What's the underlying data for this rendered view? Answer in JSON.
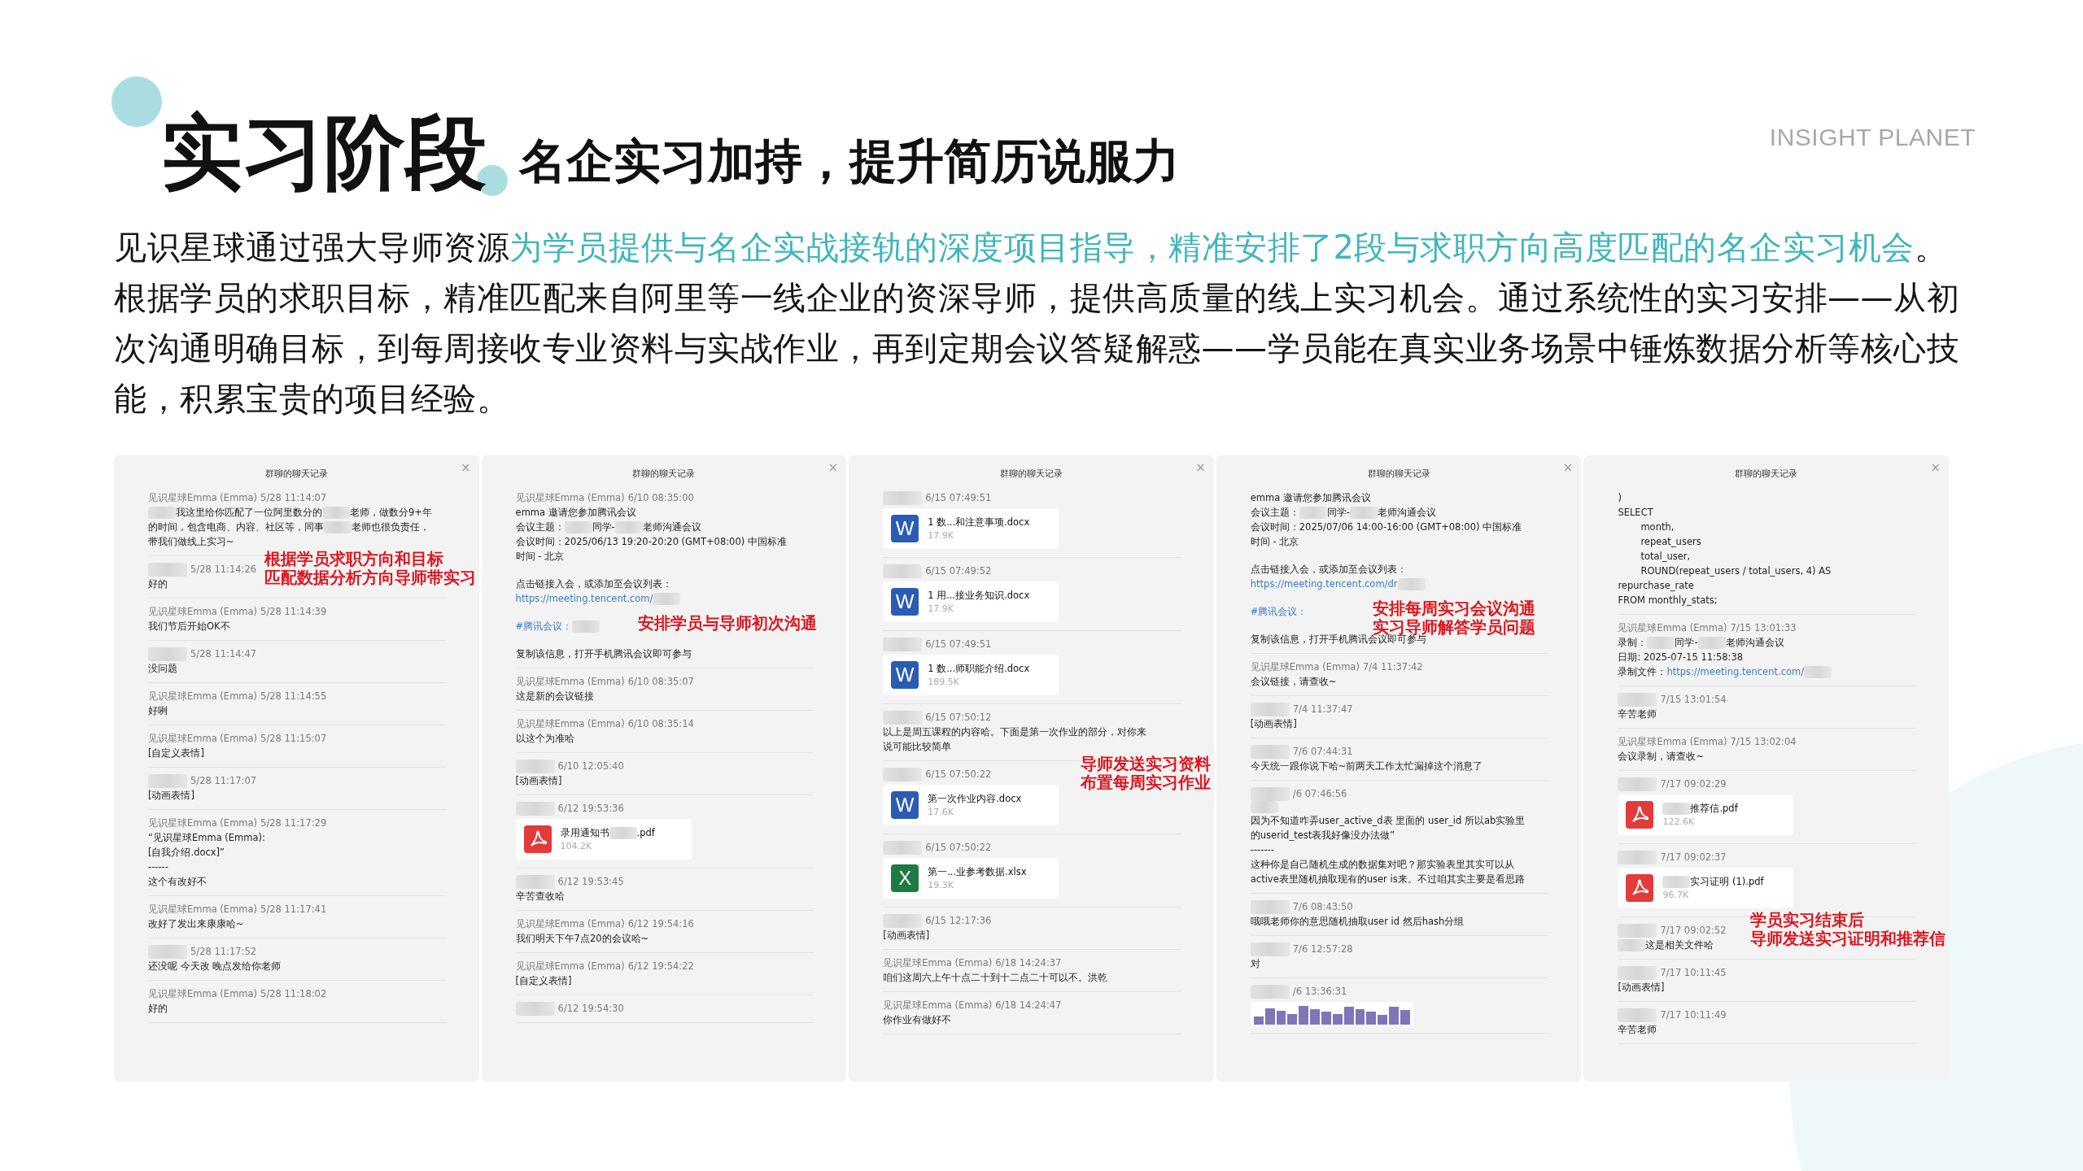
{
  "title": "实习阶段",
  "subtitle": "名企实习加持，提升简历说服力",
  "brand": "INSIGHT PLANET",
  "intro": [
    {
      "segments": [
        {
          "text": "见识星球通过强大导师资源",
          "highlight": false
        },
        {
          "text": "为学员提供与名企实战接轨的深度项目指导，精准安排了2段与求职方向高度匹配的名企实习机会",
          "highlight": true
        },
        {
          "text": "。",
          "highlight": false
        }
      ]
    },
    {
      "segments": [
        {
          "text": "根据学员的求职目标，精准匹配来自阿里等一线企业的资深导师，提供高质量的线上实习机会。通过系统性的实习安排——从初次沟通明确目标，到每周接收专业资料与实战作业，再到定期会议答疑解惑——学员能在真实业务场景中锤炼数据分析等核心技能，积累宝贵的项目经验。",
          "highlight": false
        }
      ]
    }
  ],
  "panels": [
    {
      "title": "群聊的聊天记录",
      "close": "×",
      "messages": [
        {
          "sender": "见识星球Emma (Emma)",
          "time": "5/28 11:14:07",
          "lines": [
            [
              {
                "kind": "blur"
              },
              "我这里给你匹配了一位阿里数分的",
              {
                "kind": "blur"
              },
              "老师，做数分9+年"
            ],
            [
              "的时间，包含电商、内容、社区等，同事",
              {
                "kind": "blur"
              },
              "老师也很负责任，"
            ],
            [
              "带我们做线上实习~"
            ]
          ]
        },
        {
          "time": "5/28 11:14:26",
          "lines": [
            [
              "好的"
            ]
          ],
          "note": [
            "根据学员求职方向和目标",
            "匹配数据分析方向导师带实习"
          ]
        },
        {
          "sender": "见识星球Emma (Emma)",
          "time": "5/28 11:14:39",
          "lines": [
            [
              "我们节后开始OK不"
            ]
          ]
        },
        {
          "time": "5/28 11:14:47",
          "lines": [
            [
              "没问题"
            ]
          ]
        },
        {
          "sender": "见识星球Emma (Emma)",
          "time": "5/28 11:14:55",
          "lines": [
            [
              "好咧"
            ]
          ]
        },
        {
          "sender": "见识星球Emma (Emma)",
          "time": "5/28 11:15:07",
          "lines": [
            [
              "[自定义表情]"
            ]
          ]
        },
        {
          "time": "5/28 11:17:07",
          "lines": [
            [
              "[动画表情]"
            ]
          ]
        },
        {
          "sender": "见识星球Emma (Emma)",
          "time": "5/28 11:17:29",
          "lines": [
            [
              "“见识星球Emma (Emma):"
            ],
            [
              "[自我介绍.docx]”"
            ],
            [
              "------"
            ],
            [
              "这个有改好不"
            ]
          ]
        },
        {
          "sender": "见识星球Emma (Emma)",
          "time": "5/28 11:17:41",
          "lines": [
            [
              "改好了发出来康康哈~"
            ]
          ]
        },
        {
          "time": "5/28 11:17:52",
          "lines": [
            [
              "还没呢 今天改 晚点发给你老师"
            ]
          ]
        },
        {
          "sender": "见识星球Emma (Emma)",
          "time": "5/28 11:18:02",
          "lines": [
            [
              "好的"
            ]
          ]
        }
      ]
    },
    {
      "title": "群聊的聊天记录",
      "close": "×",
      "messages": [
        {
          "sender": "见识星球Emma (Emma)",
          "time": "6/10 08:35:00",
          "lines": [
            [
              "emma 邀请您参加腾讯会议"
            ],
            [
              "会议主题：",
              {
                "kind": "blur"
              },
              "同学-",
              {
                "kind": "blur"
              },
              "老师沟通会议"
            ],
            [
              "会议时间：2025/06/13 19:20-20:20 (GMT+08:00) 中国标准"
            ],
            [
              "时间 - 北京"
            ],
            [
              {
                "kind": "gap"
              },
              "点击链接入会，或添加至会议列表："
            ],
            [
              {
                "kind": "link",
                "text": "https://meeting.tencent.com/"
              },
              {
                "kind": "blur"
              }
            ],
            [
              {
                "kind": "gap"
              },
              {
                "kind": "link",
                "text": "#腾讯会议："
              },
              {
                "kind": "blur"
              },
              {
                "kind": "note",
                "lines": [
                  "安排学员与导师初次沟通"
                ]
              }
            ],
            [
              {
                "kind": "gap"
              },
              "复制该信息，打开手机腾讯会议即可参与"
            ]
          ]
        },
        {
          "sender": "见识星球Emma (Emma)",
          "time": "6/10 08:35:07",
          "lines": [
            [
              "这是新的会议链接"
            ]
          ]
        },
        {
          "sender": "见识星球Emma (Emma)",
          "time": "6/10 08:35:14",
          "lines": [
            [
              "以这个为准哈"
            ]
          ]
        },
        {
          "time": "6/10 12:05:40",
          "lines": [
            [
              "[动画表情]"
            ]
          ]
        },
        {
          "time": "6/12 19:53:36",
          "attachment": {
            "kind": "pdf",
            "name": [
              "录用通知书",
              {
                "kind": "blur"
              },
              ".pdf"
            ],
            "size": "104.2K"
          }
        },
        {
          "time": "6/12 19:53:45",
          "lines": [
            [
              "辛苦查收哈"
            ]
          ]
        },
        {
          "sender": "见识星球Emma (Emma)",
          "time": "6/12 19:54:16",
          "lines": [
            [
              "我们明天下午7点20的会议哈~"
            ]
          ]
        },
        {
          "sender": "见识星球Emma (Emma)",
          "time": "6/12 19:54:22",
          "lines": [
            [
              "[自定义表情]"
            ]
          ]
        },
        {
          "time": "6/12 19:54:30"
        }
      ]
    },
    {
      "title": "群聊的聊天记录",
      "close": "×",
      "messages": [
        {
          "time": "6/15 07:49:51",
          "attachment": {
            "kind": "word",
            "letter": "W",
            "name": [
              "1 数...和注意事项.docx"
            ],
            "size": "17.9K"
          }
        },
        {
          "time": "6/15 07:49:52",
          "attachment": {
            "kind": "word",
            "letter": "W",
            "name": [
              "1 用...接业务知识.docx"
            ],
            "size": "17.9K"
          }
        },
        {
          "time": "6/15 07:49:51",
          "attachment": {
            "kind": "word",
            "letter": "W",
            "name": [
              "1 数...师职能介绍.docx"
            ],
            "size": "189.5K"
          }
        },
        {
          "time": "6/15 07:50:12",
          "lines": [
            [
              "以上是周五课程的内容哈。下面是第一次作业的部分，对你来"
            ],
            [
              "说可能比较简单"
            ]
          ]
        },
        {
          "time": "6/15 07:50:22",
          "attachment": {
            "kind": "word",
            "letter": "W",
            "name": [
              "第一次作业内容.docx"
            ],
            "size": "17.6K"
          },
          "note": [
            "导师发送实习资料",
            "布置每周实习作业"
          ]
        },
        {
          "time": "6/15 07:50:22",
          "attachment": {
            "kind": "excel",
            "letter": "X",
            "name": [
              "第一...业参考数据.xlsx"
            ],
            "size": "19.3K"
          }
        },
        {
          "time": "6/15 12:17:36",
          "lines": [
            [
              "[动画表情]"
            ]
          ]
        },
        {
          "sender": "见识星球Emma (Emma)",
          "time": "6/18 14:24:37",
          "lines": [
            [
              "咱们这周六上午十点二十到十二点二十可以不。洪乾"
            ]
          ]
        },
        {
          "sender": "见识星球Emma (Emma)",
          "time": "6/18 14:24:47",
          "lines": [
            [
              "你作业有做好不"
            ]
          ]
        }
      ]
    },
    {
      "title": "群聊的聊天记录",
      "close": "×",
      "messages": [
        {
          "lines": [
            [
              "emma 邀请您参加腾讯会议"
            ],
            [
              "会议主题：",
              {
                "kind": "blur"
              },
              "同学-",
              {
                "kind": "blur"
              },
              "老师沟通会议"
            ],
            [
              "会议时间：2025/07/06 14:00-16:00 (GMT+08:00) 中国标准"
            ],
            [
              "时间 - 北京"
            ],
            [
              {
                "kind": "gap"
              },
              "点击链接入会，或添加至会议列表："
            ],
            [
              {
                "kind": "link",
                "text": "https://meeting.tencent.com/dr"
              },
              {
                "kind": "blur"
              }
            ],
            [
              {
                "kind": "gap"
              },
              {
                "kind": "link",
                "text": "#腾讯会议："
              },
              {
                "kind": "note",
                "lines": [
                  "安排每周实习会议沟通",
                  "实习导师解答学员问题"
                ]
              }
            ],
            [
              {
                "kind": "gap"
              },
              "复制该信息，打开手机腾讯会议即可参与"
            ]
          ]
        },
        {
          "sender": "见识星球Emma (Emma)",
          "time": "7/4 11:37:42",
          "lines": [
            [
              "会议链接，请查收~"
            ]
          ]
        },
        {
          "time": "7/4 11:37:47",
          "lines": [
            [
              "[动画表情]"
            ]
          ]
        },
        {
          "time": "7/6 07:44:31",
          "lines": [
            [
              "今天统一跟你说下哈~前两天工作太忙漏掉这个消息了"
            ]
          ]
        },
        {
          "time": "/6 07:46:56",
          "lines": [
            [
              {
                "kind": "blur"
              }
            ],
            [
              "因为不知道咋弄user_active_d表 里面的 user_id 所以ab实验里"
            ],
            [
              "的userid_test表我好像没办法做”"
            ],
            [
              "-------"
            ],
            [
              "这种你是自己随机生成的数据集对吧？那实验表里其实可以从"
            ],
            [
              "active表里随机抽取现有的user is来。不过咱其实主要是看思路"
            ]
          ]
        },
        {
          "time": "7/6 08:43:50",
          "lines": [
            [
              "哦哦老师你的意思随机抽取user id 然后hash分组"
            ]
          ]
        },
        {
          "time": "7/6 12:57:28",
          "lines": [
            [
              "对"
            ]
          ]
        },
        {
          "time": "/6 13:36:31",
          "attachment": {
            "kind": "image"
          }
        }
      ]
    },
    {
      "title": "群聊的聊天记录",
      "close": "×",
      "messages": [
        {
          "lines": [
            [
              ")"
            ],
            [
              "SELECT"
            ],
            [
              {
                "kind": "indent"
              },
              "month,"
            ],
            [
              {
                "kind": "indent"
              },
              "repeat_users"
            ],
            [
              {
                "kind": "indent"
              },
              "total_user,"
            ],
            [
              {
                "kind": "indent"
              },
              "ROUND(repeat_users / total_users, 4) AS"
            ],
            [
              "repurchase_rate"
            ],
            [
              "FROM monthly_stats;"
            ]
          ]
        },
        {
          "sender": "见识星球Emma (Emma)",
          "time": "7/15 13:01:33",
          "lines": [
            [
              "录制：",
              {
                "kind": "blur"
              },
              "同学-",
              {
                "kind": "blur"
              },
              "老师沟通会议"
            ],
            [
              "日期: 2025-07-15 11:58:38"
            ],
            [
              "录制文件：",
              {
                "kind": "link",
                "text": "https://meeting.tencent.com/"
              },
              {
                "kind": "blur"
              }
            ]
          ]
        },
        {
          "time": "7/15 13:01:54",
          "lines": [
            [
              "辛苦老师"
            ]
          ]
        },
        {
          "sender": "见识星球Emma (Emma)",
          "time": "7/15 13:02:04",
          "lines": [
            [
              "会议录制，请查收~"
            ]
          ]
        },
        {
          "time": "7/17 09:02:29",
          "attachment": {
            "kind": "pdf",
            "name": [
              {
                "kind": "blur"
              },
              "推荐信.pdf"
            ],
            "size": "122.6K"
          }
        },
        {
          "time": "7/17 09:02:37",
          "attachment": {
            "kind": "pdf",
            "name": [
              {
                "kind": "blur"
              },
              "实习证明 (1).pdf"
            ],
            "size": "96.7K"
          }
        },
        {
          "time": "7/17 09:02:52",
          "lines": [
            [
              {
                "kind": "blur"
              },
              "这是相关文件哈"
            ]
          ],
          "note": [
            "学员实习结束后",
            "导师发送实习证明和推荐信"
          ]
        },
        {
          "time": "7/17 10:11:45",
          "lines": [
            [
              "[动画表情]"
            ]
          ]
        },
        {
          "time": "7/17 10:11:49",
          "lines": [
            [
              "辛苦老师"
            ]
          ]
        }
      ]
    }
  ]
}
